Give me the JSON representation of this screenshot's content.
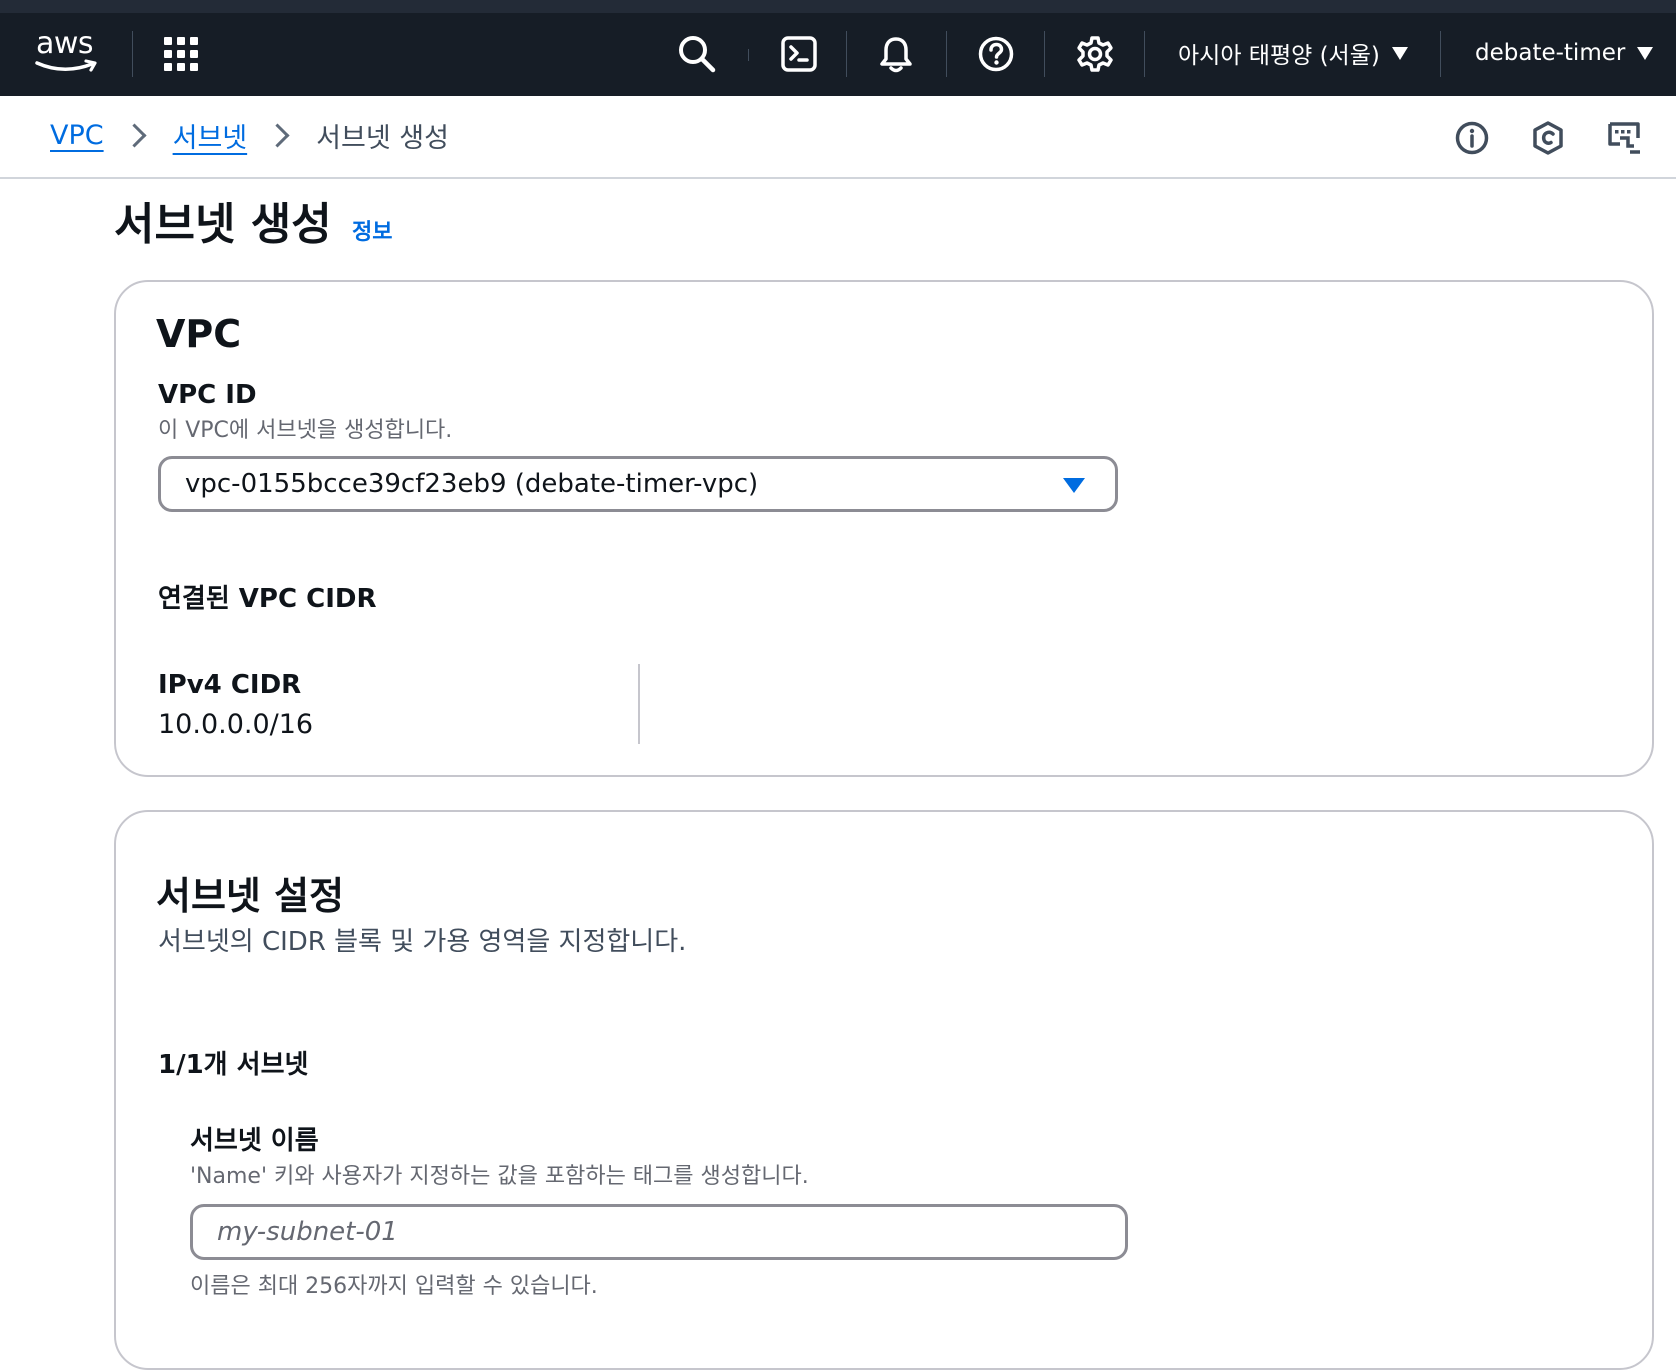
{
  "topnav": {
    "logo_text": "aws",
    "region_label": "아시아 태평양 (서울)",
    "account_label": "debate-timer",
    "icons": [
      "apps-grid-icon",
      "search-icon",
      "cloudshell-icon",
      "notifications-bell-icon",
      "help-icon",
      "settings-gear-icon"
    ]
  },
  "breadcrumb": {
    "items": [
      {
        "label": "VPC",
        "link": true
      },
      {
        "label": "서브넷",
        "link": true
      },
      {
        "label": "서브넷 생성",
        "link": false
      }
    ],
    "utility_icons": [
      "info-circle-icon",
      "security-shield-icon",
      "feedback-icon"
    ]
  },
  "page": {
    "title": "서브넷 생성",
    "info_link": "정보"
  },
  "vpc_section": {
    "heading": "VPC",
    "vpc_id_label": "VPC ID",
    "vpc_id_description": "이 VPC에 서브넷을 생성합니다.",
    "vpc_id_selected": "vpc-0155bcce39cf23eb9 (debate-timer-vpc)",
    "associated_cidr_heading": "연결된 VPC CIDR",
    "ipv4_cidr_label": "IPv4 CIDR",
    "ipv4_cidr_value": "10.0.0.0/16"
  },
  "subnet_settings": {
    "heading": "서브넷 설정",
    "description": "서브넷의 CIDR 블록 및 가용 영역을 지정합니다.",
    "count_label": "1/1개 서브넷",
    "name_label": "서브넷 이름",
    "name_description": "'Name' 키와 사용자가 지정하는 값을 포함하는 태그를 생성합니다.",
    "name_placeholder": "my-subnet-01",
    "name_value": "",
    "name_constraint": "이름은 최대 256자까지 입력할 수 있습니다."
  },
  "colors": {
    "topnav_bg": "#161d26",
    "link": "#006ce0",
    "border": "#c6c6cd",
    "text": "#0f141a",
    "secondary_text": "#656871"
  }
}
